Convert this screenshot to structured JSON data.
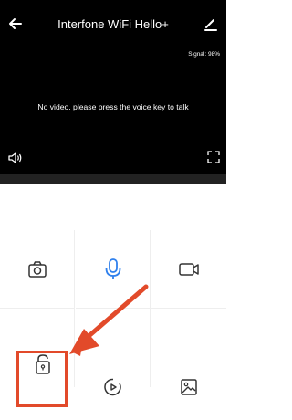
{
  "header": {
    "title": "Interfone WiFi Hello+"
  },
  "video": {
    "signal_text": "Signal: 98%",
    "message": "No video, please press the voice key to talk"
  },
  "colors": {
    "accent": "#2f80ed",
    "highlight": "#e24a2a",
    "icon": "#333333",
    "background_dark": "#000000"
  },
  "controls": [
    {
      "icon": "camera-icon"
    },
    {
      "icon": "microphone-icon"
    },
    {
      "icon": "video-record-icon"
    },
    {
      "icon": "unlock-icon"
    },
    {
      "icon": "playback-icon"
    },
    {
      "icon": "gallery-icon"
    }
  ]
}
